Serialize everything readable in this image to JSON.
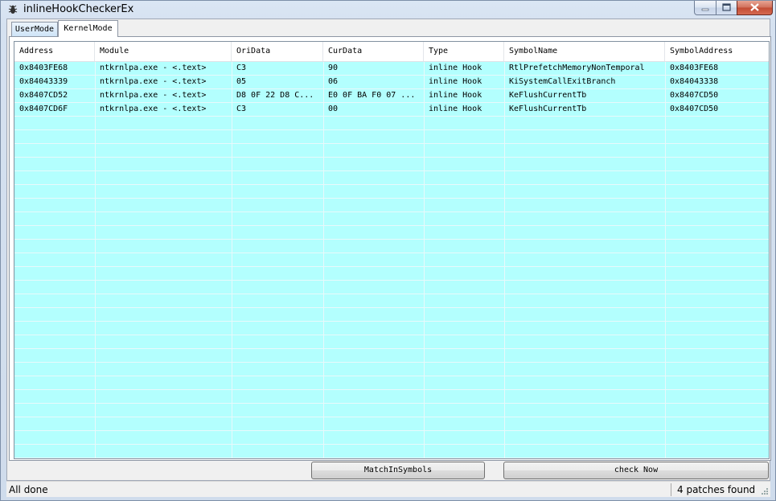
{
  "window": {
    "title": "inlineHookCheckerEx",
    "icon": "bug-icon"
  },
  "tabs": [
    {
      "label": "UserMode",
      "selected": false
    },
    {
      "label": "KernelMode",
      "selected": true
    }
  ],
  "table": {
    "columns": [
      "Address",
      "Module",
      "OriData",
      "CurData",
      "Type",
      "SymbolName",
      "SymbolAddress"
    ],
    "rows": [
      [
        "0x8403FE68",
        "ntkrnlpa.exe - <.text>",
        "C3",
        "90",
        "inline Hook",
        "RtlPrefetchMemoryNonTemporal",
        "0x8403FE68"
      ],
      [
        "0x84043339",
        "ntkrnlpa.exe - <.text>",
        "05",
        "06",
        "inline Hook",
        "KiSystemCallExitBranch",
        "0x84043338"
      ],
      [
        "0x8407CD52",
        "ntkrnlpa.exe - <.text>",
        "D8 0F 22 D8 C...",
        "E0 0F BA F0 07 ...",
        "inline Hook",
        "KeFlushCurrentTb",
        "0x8407CD50"
      ],
      [
        "0x8407CD6F",
        "ntkrnlpa.exe - <.text>",
        "C3",
        "00",
        "inline Hook",
        "KeFlushCurrentTb",
        "0x8407CD50"
      ]
    ],
    "row_background": "#b3fffe"
  },
  "buttons": {
    "match": "MatchInSymbols",
    "check": "check Now"
  },
  "status": {
    "left": "All done",
    "right": "4 patches found"
  }
}
